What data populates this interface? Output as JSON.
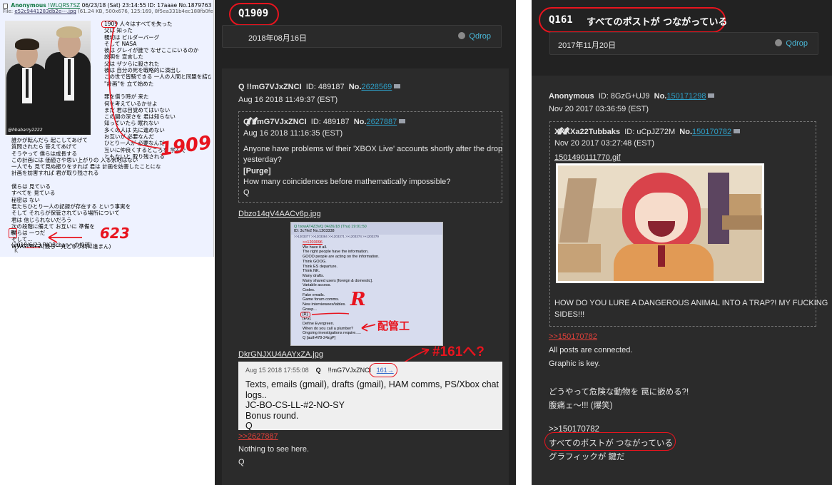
{
  "left": {
    "header": {
      "checkbox": "",
      "name": "Anonymous",
      "trip": "!WLQRS7SZ",
      "meta": "06/23/18 (Sat) 23:14:55 ID: 17aaae No.1879763"
    },
    "file": {
      "label": "File:",
      "name": "e52c9441283db2e---.jpg",
      "info": "(61.24 KB, 500x676, 125:169, 8f5ea331b4ec188fb0fe4a0f87"
    },
    "watermark": "@hbabarry2222",
    "lines_right": [
      "1909 人々はすべてを失った",
      "父は  知った",
      "親切は  ビルダーバーグ",
      "そして  NASA",
      "彼は  グレイが誰で なぜここにいるのか",
      "説明を  宣言した",
      "父は  ザツらに殺された",
      "彼は  自分の死を戦略的に演出し",
      "この世で皆騎できる  一人の人間と同盟を結び",
      "\"計画\"を  立て始めた",
      "",
      "罪を償う時が  来た",
      "何を考えているかせよ",
      "まだ  君は目覚めてはいない",
      "この闇の深さを  君は知らない",
      "知っていたら  眠れない",
      "多くの人は  先に進めない",
      "お互いが  必要なんだ",
      "ひとり一人が  必要なんだ",
      "互いに仲良くするところを  学んで",
      "ともないと  取り残される"
    ],
    "lines_bottom": [
      "誰かが転んだら  起こしてあげて",
      "質問されたら  答えてあげて",
      "そうやって  僕らは成長する",
      "この計画には  価値さや思い上がりの  入る余地はない",
      "一人でも  見て見ぬ振りをすれば  君は  計画を妨害したことになる",
      "計画を妨害すれば  君が取り残される",
      "",
      "僕らは  見ている",
      "すべてを  見ている",
      "秘密は  ない",
      "君たちひとり一人の記録が存在する  という事実を",
      "そして  それらが保管されている場所について",
      "君は  信じられないだろう",
      "次の段階に備えて  お互いに  準備を",
      "僕らは  一つだ",
      "そして...",
      "WWG1WGA(我ら一丸となり共に進まん)"
    ],
    "r_box": "R",
    "date": "(2018/6/23 RIO8chanへの投稿)",
    "k": "K",
    "ann_1909": "1909",
    "ann_623": "623"
  },
  "mid": {
    "qid": "Q1909",
    "date": "2018年08月16日",
    "qdrop": "Qdrop",
    "post": {
      "author": "Q !!mG7VJxZNCI",
      "id": "ID: 489187",
      "no_label": "No.",
      "no": "2628569",
      "date": "Aug 16 2018 11:49:37 (EST)"
    },
    "quote": {
      "author": "Q !!mG7VJxZNCI",
      "id": "ID: 489187",
      "no_label": "No.",
      "no": "2627887",
      "date": "Aug 16 2018 11:16:35 (EST)",
      "text1": "Anyone have problems w/ their 'XBOX Live' accounts shortly after the drop",
      "text2": "yesterday?",
      "purge": "[Purge]",
      "text3": "How many coincidences before mathematically impossible?",
      "sig": "Q"
    },
    "image1_name": "Dbzo14qV4AACv6p.jpg",
    "shot1": {
      "header": "Q !xowAT4Z3VQ  04/26/18 (Thu) 19:01:50",
      "id": "ID: 3c7fe2  No.1203338",
      "links": ">>1203377  >>1203384  >>1203371  >>1203374  >>1203379",
      "reply": ">>1203096",
      "lines": [
        "We have it all.",
        "The right people have the information.",
        "GOOD people are acting on the information.",
        "Think GOOG.",
        "Think ES departure.",
        "Think NK.",
        "Many drafts.",
        "Many shared users [foreign & domestic].",
        "Variable access.",
        "Codes.",
        "Fake emails.",
        "Game forum comms.",
        "New interviewees/tables.",
        "Group...",
        "[R].",
        "[EG].",
        "Define Evergreen.",
        "When do you call a plumber?",
        "Ongoing investigations require.....",
        "Q [auth478-24zgP]"
      ],
      "ann_r": "R",
      "ann_plumber": "配管工"
    },
    "image2_name": "DkrGNJXU4AAYxZA.jpg",
    "ann_161": "#161へ?",
    "shot2": {
      "date": "Aug 15 2018 17:55:08",
      "q": "Q",
      "trip": "!!mG7VJxZNCI",
      "link": "161→",
      "line1": "Texts, emails (gmail), drafts (gmail), HAM comms, PS/Xbox chat",
      "line2": "logs..",
      "line3": "JC-BO-CS-LL-#2-NO-SY",
      "line4": "Bonus round.",
      "line5": "Q"
    },
    "reply_link": ">>2627887",
    "reply_text": "Nothing to see here.",
    "reply_sig": "Q"
  },
  "right": {
    "qid": "Q161",
    "title": "すべてのポストが つながっている",
    "date": "2017年11月20日",
    "qdrop": "Qdrop",
    "post": {
      "author": "Anonymous",
      "id": "ID: 8GzG+UJ9",
      "no_label": "No.",
      "no": "150171298",
      "date": "Nov 20 2017 03:36:59 (EST)"
    },
    "quote": {
      "author": "XXXXa22Tubbaks",
      "id": "ID: uCpJZ72M",
      "no_label": "No.",
      "no": "150170782",
      "date": "Nov 20 2017 03:27:48 (EST)",
      "file": "1501490111770.gif",
      "text1": "HOW DO YOU LURE A DANGEROUS ANIMAL INTO A TRAP?! MY FUCKING",
      "text2": "SIDES!!!"
    },
    "reply_link": ">>150170782",
    "line1": "All posts are connected.",
    "line2": "Graphic is key.",
    "jp1": "どうやって危険な動物を 罠に嵌める?!",
    "jp2": "腹痛ェ〜!!! (爆笑)",
    "ref2": ">>150170782",
    "jp3": "すべてのポストが つながっている",
    "jp4": "グラフィックが 鍵だ"
  }
}
